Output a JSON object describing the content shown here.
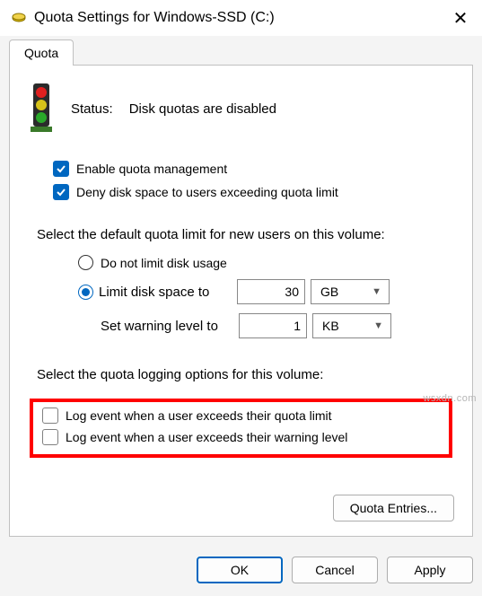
{
  "titlebar": {
    "title": "Quota Settings for Windows-SSD (C:)",
    "close_glyph": "✕"
  },
  "tabs": [
    {
      "label": "Quota"
    }
  ],
  "status": {
    "label": "Status:",
    "text": "Disk quotas are disabled"
  },
  "options": {
    "enable_management": {
      "label": "Enable quota management",
      "checked": true
    },
    "deny_exceeding": {
      "label": "Deny disk space to users exceeding quota limit",
      "checked": true
    }
  },
  "limit_section": {
    "heading": "Select the default quota limit for new users on this volume:",
    "no_limit": {
      "label": "Do not limit disk usage",
      "selected": false
    },
    "limit": {
      "label": "Limit disk space to",
      "selected": true,
      "value": "30",
      "unit": "GB"
    },
    "warning": {
      "label": "Set warning level to",
      "value": "1",
      "unit": "KB"
    }
  },
  "log_section": {
    "heading": "Select the quota logging options for this volume:",
    "log_quota": {
      "label": "Log event when a user exceeds their quota limit",
      "checked": false
    },
    "log_warning": {
      "label": "Log event when a user exceeds their warning level",
      "checked": false
    }
  },
  "buttons": {
    "quota_entries": "Quota Entries...",
    "ok": "OK",
    "cancel": "Cancel",
    "apply": "Apply"
  },
  "watermark": "wsxdn.com"
}
